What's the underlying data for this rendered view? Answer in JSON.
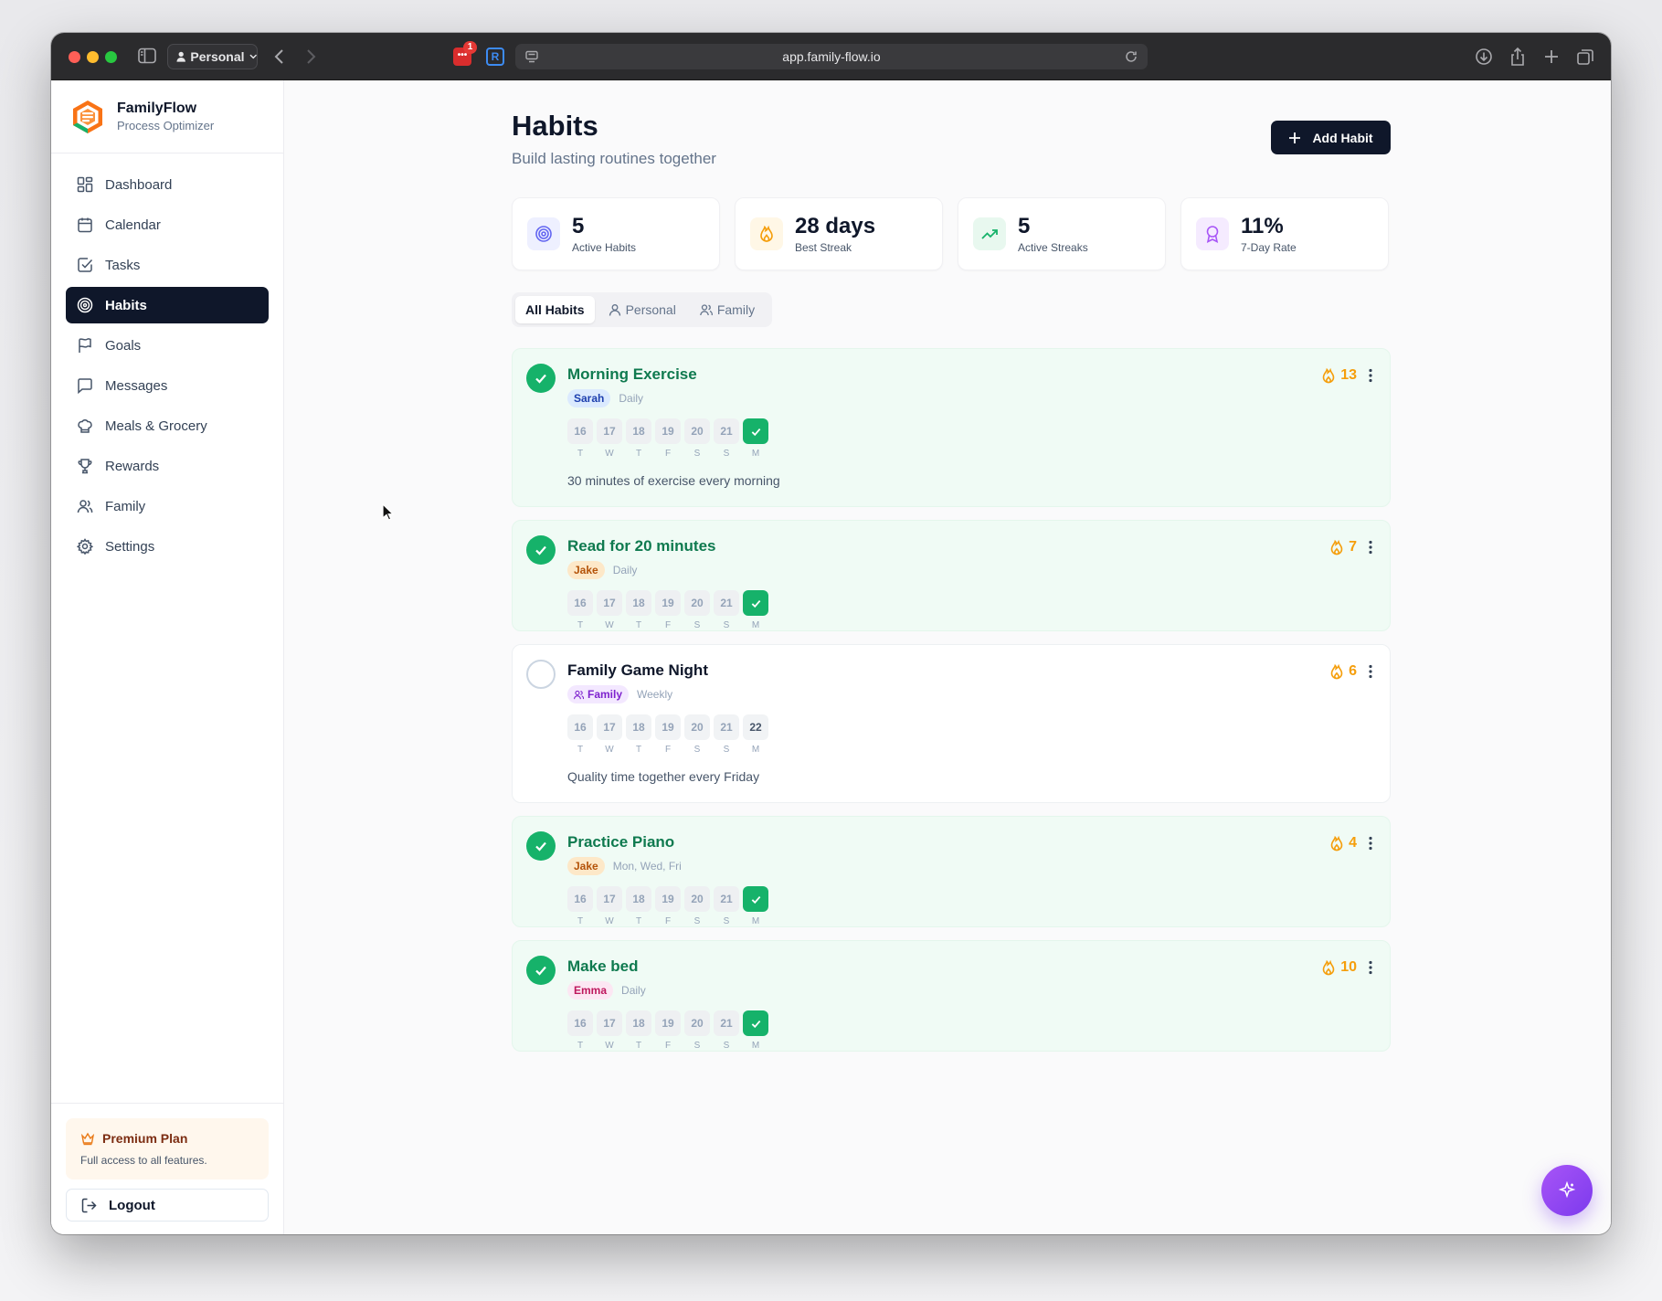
{
  "browser": {
    "profile": "Personal",
    "url": "app.family-flow.io",
    "extension_badge": "1",
    "extension2_letter": "R"
  },
  "app": {
    "name": "FamilyFlow",
    "tagline": "Process Optimizer"
  },
  "sidebar": {
    "items": [
      {
        "label": "Dashboard",
        "icon": "grid-icon"
      },
      {
        "label": "Calendar",
        "icon": "calendar-icon"
      },
      {
        "label": "Tasks",
        "icon": "checkbox-icon"
      },
      {
        "label": "Habits",
        "icon": "target-icon",
        "active": true
      },
      {
        "label": "Goals",
        "icon": "flag-icon"
      },
      {
        "label": "Messages",
        "icon": "message-icon"
      },
      {
        "label": "Meals & Grocery",
        "icon": "chef-hat-icon"
      },
      {
        "label": "Rewards",
        "icon": "trophy-icon"
      },
      {
        "label": "Family",
        "icon": "users-icon"
      },
      {
        "label": "Settings",
        "icon": "gear-icon"
      }
    ],
    "premium": {
      "title": "Premium Plan",
      "description": "Full access to all features."
    },
    "logout_label": "Logout"
  },
  "page": {
    "title": "Habits",
    "subtitle": "Build lasting routines together",
    "add_button": "Add Habit"
  },
  "stats": [
    {
      "value": "5",
      "label": "Active Habits",
      "color": "#6366f1"
    },
    {
      "value": "28 days",
      "label": "Best Streak",
      "color": "#f59e0b"
    },
    {
      "value": "5",
      "label": "Active Streaks",
      "color": "#16b26a"
    },
    {
      "value": "11%",
      "label": "7-Day Rate",
      "color": "#a855f7"
    }
  ],
  "filters": {
    "all": "All Habits",
    "personal": "Personal",
    "family": "Family"
  },
  "habits": [
    {
      "name": "Morning Exercise",
      "assignee": "Sarah",
      "frequency": "Daily",
      "streak": "13",
      "done": true,
      "description": "30 minutes of exercise every morning",
      "days": [
        "16",
        "17",
        "18",
        "19",
        "20",
        "21"
      ],
      "day_letters": [
        "T",
        "W",
        "T",
        "F",
        "S",
        "S",
        "M"
      ]
    },
    {
      "name": "Read for 20 minutes",
      "assignee": "Jake",
      "frequency": "Daily",
      "streak": "7",
      "done": true,
      "description": "",
      "days": [
        "16",
        "17",
        "18",
        "19",
        "20",
        "21"
      ],
      "day_letters": [
        "T",
        "W",
        "T",
        "F",
        "S",
        "S",
        "M"
      ]
    },
    {
      "name": "Family Game Night",
      "assignee": "Family",
      "frequency": "Weekly",
      "streak": "6",
      "done": false,
      "description": "Quality time together every Friday",
      "days": [
        "16",
        "17",
        "18",
        "19",
        "20",
        "21",
        "22"
      ],
      "day_letters": [
        "T",
        "W",
        "T",
        "F",
        "S",
        "S",
        "M"
      ]
    },
    {
      "name": "Practice Piano",
      "assignee": "Jake",
      "frequency": "Mon, Wed, Fri",
      "streak": "4",
      "done": true,
      "description": "",
      "days": [
        "16",
        "17",
        "18",
        "19",
        "20",
        "21"
      ],
      "day_letters": [
        "T",
        "W",
        "T",
        "F",
        "S",
        "S",
        "M"
      ]
    },
    {
      "name": "Make bed",
      "assignee": "Emma",
      "frequency": "Daily",
      "streak": "10",
      "done": true,
      "description": "",
      "days": [
        "16",
        "17",
        "18",
        "19",
        "20",
        "21"
      ],
      "day_letters": [
        "T",
        "W",
        "T",
        "F",
        "S",
        "S",
        "M"
      ]
    }
  ]
}
